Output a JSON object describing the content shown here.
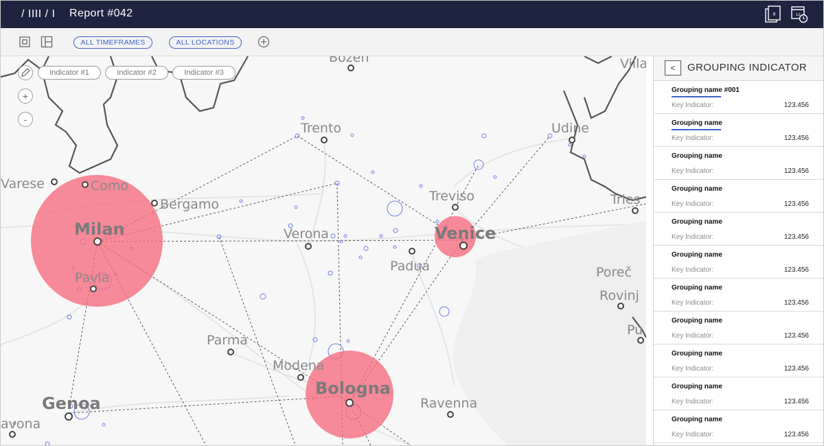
{
  "header": {
    "breadcrumb": "/ IIII / I",
    "title": "Report #042",
    "icons": [
      "pages-icon",
      "calendar-clock-icon"
    ],
    "background": "#1e2440"
  },
  "toolbar": {
    "icons": [
      "square-view-icon",
      "layout-icon",
      "add-filter-icon"
    ],
    "filters": [
      {
        "label": "ALL TIMEFRAMES"
      },
      {
        "label": "ALL LOCATIONS"
      }
    ],
    "accent": "#3e63c9"
  },
  "map": {
    "indicators": [
      {
        "label": "Indicator #1"
      },
      {
        "label": "Indicator #2"
      },
      {
        "label": "Indicator #3"
      }
    ],
    "zoom_in": "+",
    "zoom_out": "-",
    "bubble_color": "#f76b7e",
    "cities": [
      {
        "name": "Bozen"
      },
      {
        "name": "Villa"
      },
      {
        "name": "Trento"
      },
      {
        "name": "Udine"
      },
      {
        "name": "Varese"
      },
      {
        "name": "Como"
      },
      {
        "name": "Bergamo"
      },
      {
        "name": "Treviso"
      },
      {
        "name": "Tries"
      },
      {
        "name": "Milan"
      },
      {
        "name": "Verona"
      },
      {
        "name": "Venice"
      },
      {
        "name": "Padua"
      },
      {
        "name": "Pavia"
      },
      {
        "name": "Poreč"
      },
      {
        "name": "Rovinj"
      },
      {
        "name": "Parma"
      },
      {
        "name": "Pu"
      },
      {
        "name": "Modena"
      },
      {
        "name": "Bologna"
      },
      {
        "name": "Genoa"
      },
      {
        "name": "Ravenna"
      },
      {
        "name": "avona"
      }
    ]
  },
  "panel": {
    "back_label": "<",
    "title": "GROUPING INDICATOR",
    "groups": [
      {
        "name": "Grouping name #001",
        "key_label": "Key Indicator:",
        "value": "123.456",
        "selected": true
      },
      {
        "name": "Grouping name",
        "key_label": "Key Indicator:",
        "value": "123.456",
        "selected": true
      },
      {
        "name": "Grouping name",
        "key_label": "Key Indicator:",
        "value": "123.456",
        "selected": false
      },
      {
        "name": "Grouping name",
        "key_label": "Key Indicator:",
        "value": "123.456",
        "selected": false
      },
      {
        "name": "Grouping name",
        "key_label": "Key Indicator:",
        "value": "123.456",
        "selected": false
      },
      {
        "name": "Grouping name",
        "key_label": "Key Indicator:",
        "value": "123.456",
        "selected": false
      },
      {
        "name": "Grouping name",
        "key_label": "Key Indicator:",
        "value": "123.456",
        "selected": false
      },
      {
        "name": "Grouping name",
        "key_label": "Key Indicator:",
        "value": "123.456",
        "selected": false
      },
      {
        "name": "Grouping name",
        "key_label": "Key Indicator:",
        "value": "123.456",
        "selected": false
      },
      {
        "name": "Grouping name",
        "key_label": "Key Indicator:",
        "value": "123.456",
        "selected": false
      },
      {
        "name": "Grouping name",
        "key_label": "Key Indicator:",
        "value": "123.456",
        "selected": false
      }
    ]
  }
}
